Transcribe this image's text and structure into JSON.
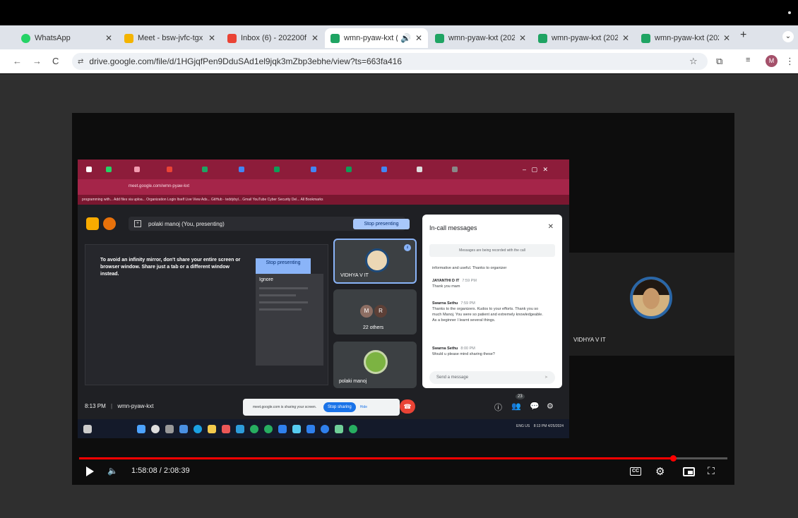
{
  "browser": {
    "tabs": [
      {
        "title": "WhatsApp",
        "favicon_color": "#25d366"
      },
      {
        "title": "Meet - bsw-jvfc-tgx",
        "favicon_color": "#f4b400"
      },
      {
        "title": "Inbox (6) - 202200f…",
        "favicon_color": "#ea4335"
      },
      {
        "title": "wmn-pyaw-kxt (2",
        "favicon_color": "#1fa463",
        "active": true
      },
      {
        "title": "wmn-pyaw-kxt (202",
        "favicon_color": "#1fa463"
      },
      {
        "title": "wmn-pyaw-kxt (202",
        "favicon_color": "#1fa463"
      },
      {
        "title": "wmn-pyaw-kxt (202",
        "favicon_color": "#1fa463"
      }
    ],
    "url": "drive.google.com/file/d/1HGjqfPen9DduSAd1el9jqk3mZbp3ebhe/view?ts=663fa416"
  },
  "shared_screen": {
    "inner_url": "meet.google.com/wmn-pyaw-kxt",
    "bookmarks": "programming with...   Add files via uploa...   Organization Login   Itself Live View Ads...   GitHub - teddybyl...   Gmail   YouTube   Cyber Security Del...   All Bookmarks",
    "presenting_label": "polaki manoj (You, presenting)",
    "stop_presenting": "Stop presenting",
    "mirror_warning": "To avoid an infinity mirror, don't share your entire screen or browser window. Share just a tab or a different window instead.",
    "mirror_stop": "Stop presenting",
    "mirror_ignore": "Ignore",
    "tiles": [
      {
        "name": "VIDHYA V IT"
      },
      {
        "name": "22 others",
        "initials": [
          "M",
          "R"
        ]
      },
      {
        "name": "polaki manoj"
      }
    ],
    "chat": {
      "header": "In-call messages",
      "notice": "Messages are being recorded with the call",
      "messages": [
        {
          "who": "",
          "time": "",
          "text": "informative and useful. Thanks to organizer"
        },
        {
          "who": "JAYANTHI D IT",
          "time": "7:59 PM",
          "text": "Thank you mam"
        },
        {
          "who": "Swarna Sethu",
          "time": "7:59 PM",
          "text": "Thanks to the organizers. Kudos to your efforts. Thank you so much Manoj. You were so patient and extremely knowledgeable. As a beginner I learnt several things."
        },
        {
          "who": "Swarna Sethu",
          "time": "8:00 PM",
          "text": "Would u please mind sharing these?"
        }
      ],
      "send_placeholder": "Send a message"
    },
    "clock": "8:13 PM",
    "meeting_code": "wmn-pyaw-kxt",
    "share_notice": "meet.google.com is sharing your screen.",
    "stop_sharing": "Stop sharing",
    "hide": "Hide",
    "participant_count": "23",
    "tray_time": "8:13 PM",
    "tray_date": "4/25/2024",
    "tray_lang": "ENG US"
  },
  "side_participant": {
    "name": "VIDHYA V IT"
  },
  "player": {
    "time": "1:58:08 / 2:08:39",
    "progress": 0.916,
    "cc": "CC"
  }
}
